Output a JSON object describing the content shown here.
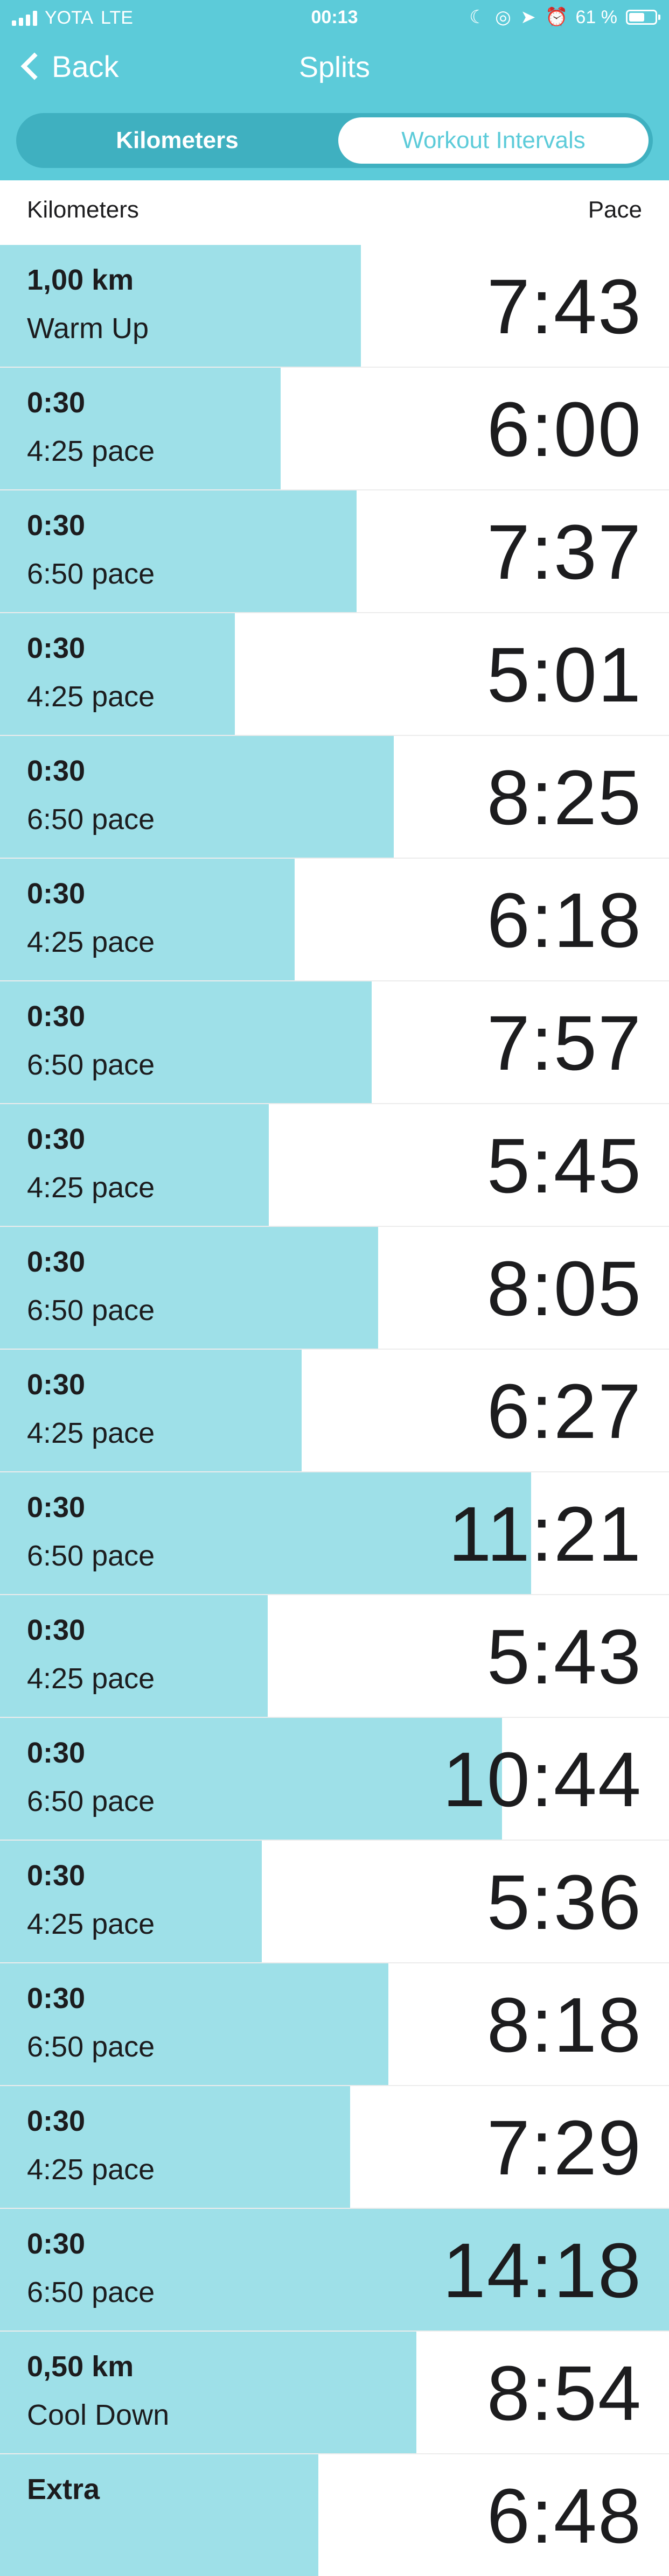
{
  "status_bar": {
    "carrier": "YOTA",
    "network": "LTE",
    "time": "00:13",
    "icons": "☾ ◎ ➤ ⏰",
    "icon_names": [
      "moon-icon",
      "location-lock-icon",
      "location-arrow-icon",
      "alarm-icon"
    ],
    "battery_percent": "61 %",
    "battery_level": 0.61
  },
  "nav": {
    "back_label": "Back",
    "title": "Splits"
  },
  "segments": {
    "kilometers": "Kilometers",
    "workout_intervals": "Workout Intervals",
    "selected": "workout_intervals"
  },
  "columns": {
    "left": "Kilometers",
    "right": "Pace"
  },
  "colors": {
    "accent": "#5ccbd9",
    "bar": "#9ee0e8",
    "segment_track": "#3fb0c0"
  },
  "pace_scale_max": "14:18",
  "splits": [
    {
      "line1": "1,00 km",
      "line2": "Warm Up",
      "pace": "7:43",
      "pace_seconds": 463
    },
    {
      "line1": "0:30",
      "line2": "4:25 pace",
      "pace": "6:00",
      "pace_seconds": 360
    },
    {
      "line1": "0:30",
      "line2": "6:50 pace",
      "pace": "7:37",
      "pace_seconds": 457
    },
    {
      "line1": "0:30",
      "line2": "4:25 pace",
      "pace": "5:01",
      "pace_seconds": 301
    },
    {
      "line1": "0:30",
      "line2": "6:50 pace",
      "pace": "8:25",
      "pace_seconds": 505
    },
    {
      "line1": "0:30",
      "line2": "4:25 pace",
      "pace": "6:18",
      "pace_seconds": 378
    },
    {
      "line1": "0:30",
      "line2": "6:50 pace",
      "pace": "7:57",
      "pace_seconds": 477
    },
    {
      "line1": "0:30",
      "line2": "4:25 pace",
      "pace": "5:45",
      "pace_seconds": 345
    },
    {
      "line1": "0:30",
      "line2": "6:50 pace",
      "pace": "8:05",
      "pace_seconds": 485
    },
    {
      "line1": "0:30",
      "line2": "4:25 pace",
      "pace": "6:27",
      "pace_seconds": 387
    },
    {
      "line1": "0:30",
      "line2": "6:50 pace",
      "pace": "11:21",
      "pace_seconds": 681
    },
    {
      "line1": "0:30",
      "line2": "4:25 pace",
      "pace": "5:43",
      "pace_seconds": 343
    },
    {
      "line1": "0:30",
      "line2": "6:50 pace",
      "pace": "10:44",
      "pace_seconds": 644
    },
    {
      "line1": "0:30",
      "line2": "4:25 pace",
      "pace": "5:36",
      "pace_seconds": 336
    },
    {
      "line1": "0:30",
      "line2": "6:50 pace",
      "pace": "8:18",
      "pace_seconds": 498
    },
    {
      "line1": "0:30",
      "line2": "4:25 pace",
      "pace": "7:29",
      "pace_seconds": 449
    },
    {
      "line1": "0:30",
      "line2": "6:50 pace",
      "pace": "14:18",
      "pace_seconds": 858
    },
    {
      "line1": "0,50 km",
      "line2": "Cool Down",
      "pace": "8:54",
      "pace_seconds": 534
    },
    {
      "line1": "Extra",
      "line2": "",
      "pace": "6:48",
      "pace_seconds": 408
    }
  ]
}
